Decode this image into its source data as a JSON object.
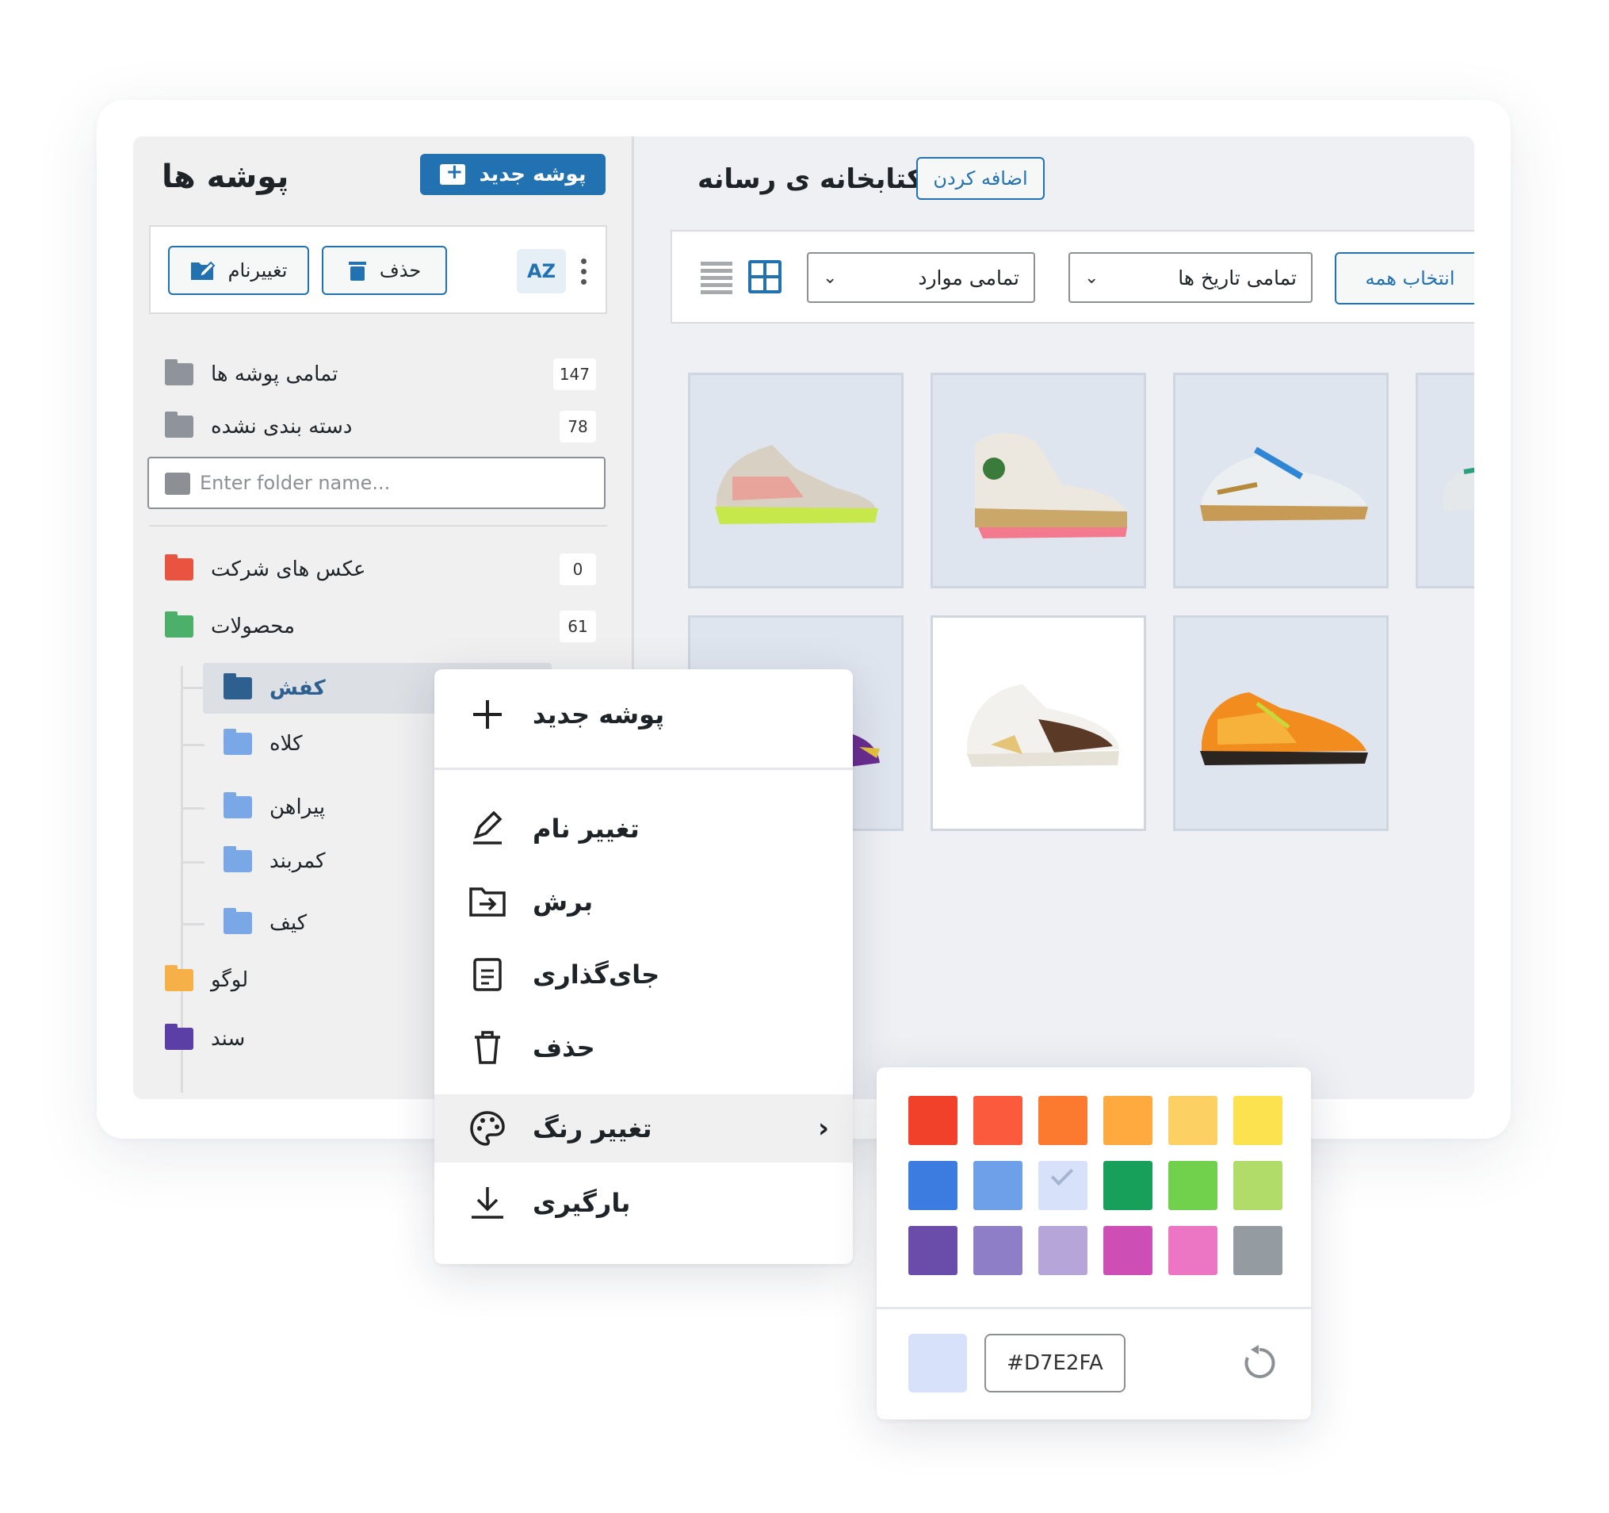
{
  "folders_panel": {
    "title": "پوشه ها",
    "new_folder_label": "پوشه جدید",
    "rename_label": "تغییرنام",
    "delete_label": "حذف",
    "sort_glyph": "AZ",
    "all_folders": {
      "label": "تمامی پوشه ها",
      "count": "147"
    },
    "uncategorized": {
      "label": "دسته بندی نشده",
      "count": "78"
    },
    "search_placeholder": "Enter folder name...",
    "tree": [
      {
        "label": "عکس های شرکت",
        "count": "0",
        "color": "#e8543f"
      },
      {
        "label": "محصولات",
        "count": "61",
        "color": "#4caf6a"
      }
    ],
    "subfolders": [
      {
        "label": "کفش",
        "color": "#2d5f8f",
        "active": true
      },
      {
        "label": "کلاه",
        "color": "#7aa7e6"
      },
      {
        "label": "پیراهن",
        "color": "#7aa7e6"
      },
      {
        "label": "کمربند",
        "color": "#7aa7e6"
      },
      {
        "label": "کیف",
        "color": "#7aa7e6"
      }
    ],
    "bottom_folders": [
      {
        "label": "لوگو",
        "color": "#f5b048"
      },
      {
        "label": "سند",
        "color": "#5b3fa6"
      }
    ]
  },
  "media_library": {
    "title": "کتابخانه ی رسانه",
    "add_label": "اضافه کردن",
    "type_filter": "تمامی موارد",
    "date_filter": "تمامی تاریخ ها",
    "select_all_label": "انتخاب همه"
  },
  "context_menu": {
    "items": [
      {
        "label": "پوشه جدید",
        "icon": "plus-icon"
      },
      {
        "label": "تغییر نام",
        "icon": "pencil-icon"
      },
      {
        "label": "برش",
        "icon": "folder-move-icon"
      },
      {
        "label": "جای‌گذاری",
        "icon": "clipboard-icon"
      },
      {
        "label": "حذف",
        "icon": "trash-icon"
      },
      {
        "label": "تغییر رنگ",
        "icon": "palette-icon"
      },
      {
        "label": "بارگیری",
        "icon": "download-icon"
      }
    ]
  },
  "color_picker": {
    "swatches": [
      "#f1412b",
      "#fb5a3c",
      "#fb7a2f",
      "#feaa3f",
      "#fdd064",
      "#fce24f",
      "#3c7be0",
      "#6ea0ea",
      "#d7e2fa",
      "#16a05a",
      "#71d14d",
      "#b2dc69",
      "#6a4cab",
      "#8d7ec7",
      "#b5a5d8",
      "#cd4eb5",
      "#ec76c4",
      "#959ca1"
    ],
    "selected_index": 8,
    "hex_value": "#D7E2FA"
  }
}
